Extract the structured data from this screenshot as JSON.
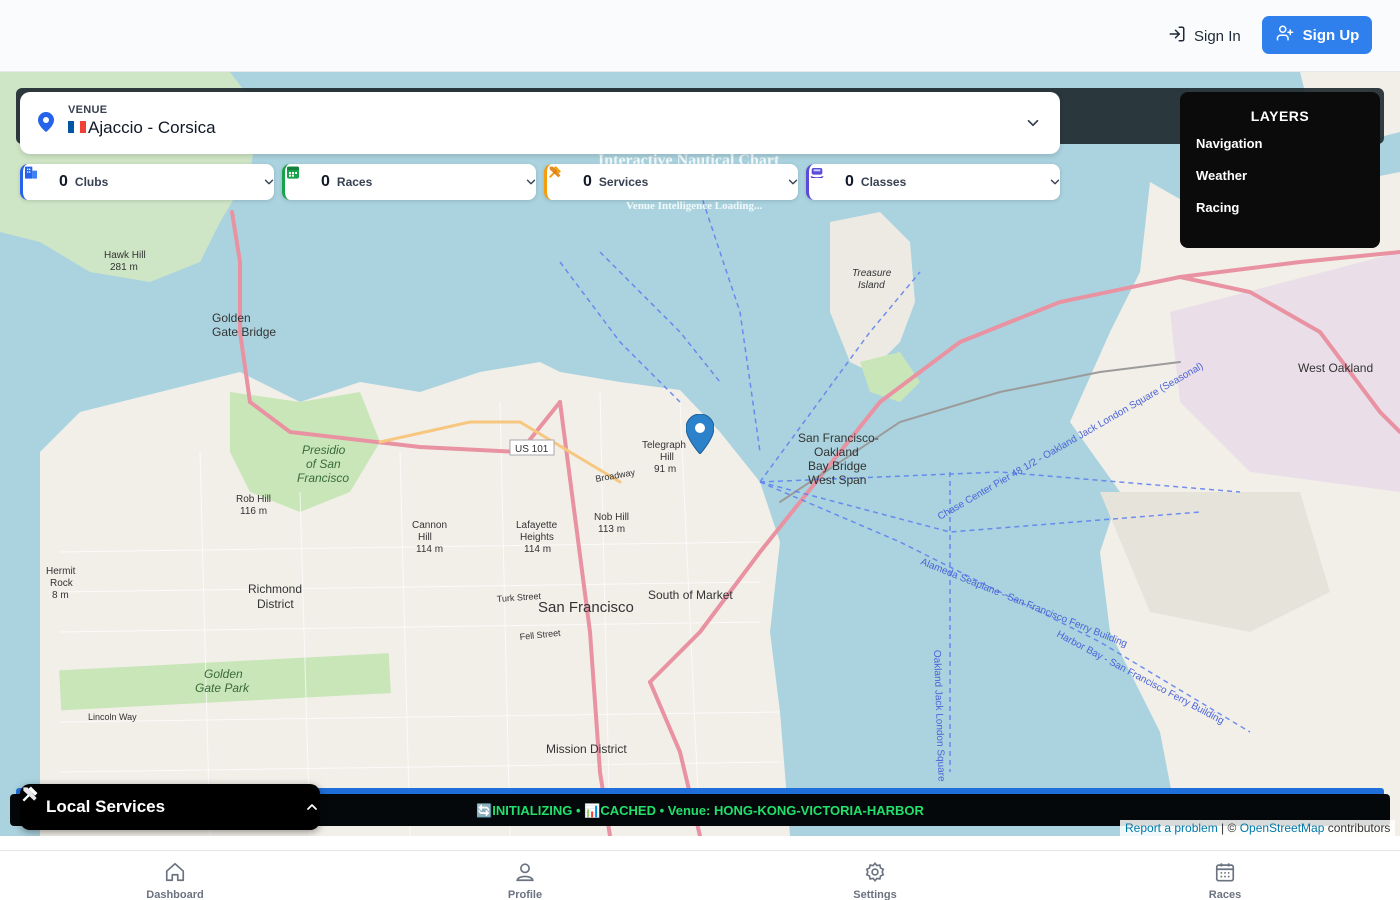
{
  "header": {
    "sign_in_label": "Sign In",
    "sign_up_label": "Sign Up",
    "sign_in_icon": "login-icon",
    "sign_up_icon": "user-plus-icon",
    "accent_color": "#2f80ed"
  },
  "map": {
    "overlay_title": "Interactive Nautical Chart",
    "overlay_subtitle": "Venue Intelligence Loading...",
    "labels": {
      "golden_gate_bridge": [
        "Golden",
        "Gate Bridge"
      ],
      "san_francisco": "San Francisco",
      "south_of_market": "South of Market",
      "bay_bridge": [
        "San Francisco-",
        "Oakland",
        "Bay Bridge",
        "West Span"
      ],
      "west_oakland": "West Oakland",
      "treasure_island": [
        "Treasure",
        "Island"
      ],
      "richmond_district": [
        "Richmond",
        "District"
      ],
      "mission_district": "Mission District",
      "golden_gate_park": [
        "Golden",
        "Gate Park"
      ],
      "presidio": [
        "Presidio",
        "of San",
        "Francisco"
      ],
      "hawk_hill": [
        "Hawk Hill",
        "281 m"
      ],
      "telegraph_hill": [
        "Telegraph",
        "Hill",
        "91 m"
      ],
      "nob_hill": [
        "Nob Hill",
        "113 m"
      ],
      "lafayette_heights": [
        "Lafayette",
        "Heights",
        "114 m"
      ],
      "cannon_hill": [
        "Cannon",
        "Hill",
        "114 m"
      ],
      "hermit_rock": [
        "Hermit",
        "Rock",
        "8 m"
      ],
      "rob_hill": [
        "Rob Hill",
        "116 m"
      ],
      "us101": "US 101",
      "broadway": "Broadway",
      "turk_street": "Turk Street",
      "fell_street": "Fell Street",
      "lincoln_way": "Lincoln Way",
      "ferry_route_1": "Alameda Seaplane - San Francisco Ferry Building",
      "ferry_route_2": "Chase Center Pier 48 1/2 - Oakland Jack London Square (Seasonal)",
      "ferry_route_3": "Harbor Bay - San Francisco Ferry Building",
      "ferry_route_4": "Oakland Jack London Square"
    },
    "venue": {
      "label": "VENUE",
      "value": "Ajaccio - Corsica",
      "icon": "location-pin-icon",
      "flag_colors": [
        "#0055a4",
        "#ffffff",
        "#ef4135"
      ]
    },
    "filters": [
      {
        "count": "0",
        "label": "Clubs",
        "icon": "building-icon",
        "color": "#2563eb"
      },
      {
        "count": "0",
        "label": "Races",
        "icon": "calendar-icon",
        "color": "#16a34a"
      },
      {
        "count": "0",
        "label": "Services",
        "icon": "tools-icon",
        "color": "#f59e0b"
      },
      {
        "count": "0",
        "label": "Classes",
        "icon": "sailboat-icon",
        "color": "#5b4bd6"
      }
    ],
    "layers": {
      "title": "LAYERS",
      "items": [
        "Navigation",
        "Weather",
        "Racing"
      ]
    },
    "status": "🔄INITIALIZING • 📊CACHED • Venue: HONG-KONG-VICTORIA-HARBOR",
    "status_color": "#22e06b",
    "local_services": {
      "label": "Local Services",
      "icon": "tools-icon"
    },
    "attribution": {
      "report": "Report a problem",
      "sep": " | © ",
      "osm": "OpenStreetMap",
      "rest": " contributors"
    }
  },
  "nav": {
    "items": [
      {
        "label": "Dashboard",
        "icon": "home-icon"
      },
      {
        "label": "Profile",
        "icon": "user-icon"
      },
      {
        "label": "Settings",
        "icon": "gear-icon"
      },
      {
        "label": "Races",
        "icon": "calendar-icon"
      }
    ]
  }
}
